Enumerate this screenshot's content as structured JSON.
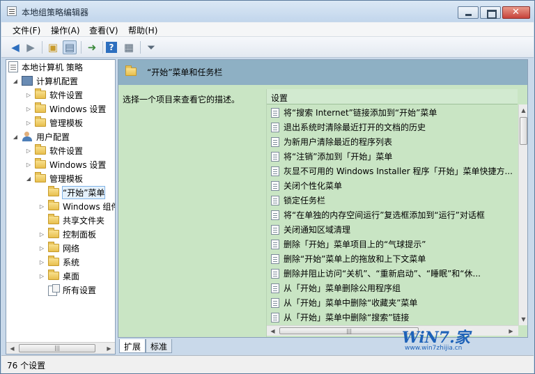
{
  "window": {
    "title": "本地组策略编辑器"
  },
  "menu": [
    "文件(F)",
    "操作(A)",
    "查看(V)",
    "帮助(H)"
  ],
  "toolbar": [
    "back-icon",
    "forward-icon",
    "up-folder-icon",
    "show-hide-tree-icon",
    "export-list-icon",
    "help-icon",
    "properties-icon",
    "filter-icon"
  ],
  "tree": {
    "root": "本地计算机 策略",
    "computer": "计算机配置",
    "computer_children": [
      "软件设置",
      "Windows 设置",
      "管理模板"
    ],
    "user": "用户配置",
    "user_children": [
      "软件设置",
      "Windows 设置",
      "管理模板"
    ],
    "admin_children": [
      "“开始”菜单",
      "Windows 组件",
      "共享文件夹",
      "控制面板",
      "网络",
      "系统",
      "桌面",
      "所有设置"
    ]
  },
  "panel": {
    "title": "“开始”菜单和任务栏",
    "description": "选择一个项目来查看它的描述。",
    "column": "设置",
    "settings": [
      "将“搜索 Internet”链接添加到“开始”菜单",
      "退出系统时清除最近打开的文档的历史",
      "为新用户清除最近的程序列表",
      "将“注销”添加到「开始」菜单",
      "灰显不可用的 Windows Installer 程序「开始」菜单快捷方...",
      "关闭个性化菜单",
      "锁定任务栏",
      "将“在单独的内存空间运行”复选框添加到“运行”对话框",
      "关闭通知区域清理",
      "删除「开始」菜单项目上的“气球提示”",
      "删除“开始”菜单上的拖放和上下文菜单",
      "删除并阻止访问“关机”、“重新启动”、“睡眠”和“休...",
      "从「开始」菜单删除公用程序组",
      "从「开始」菜单中删除“收藏夹”菜单",
      "从「开始」菜单中删除“搜索”链接"
    ]
  },
  "tabs": [
    "扩展",
    "标准"
  ],
  "status": "76 个设置",
  "watermark": {
    "logo": "WiN7.家",
    "url": "www.win7zhijia.cn"
  }
}
